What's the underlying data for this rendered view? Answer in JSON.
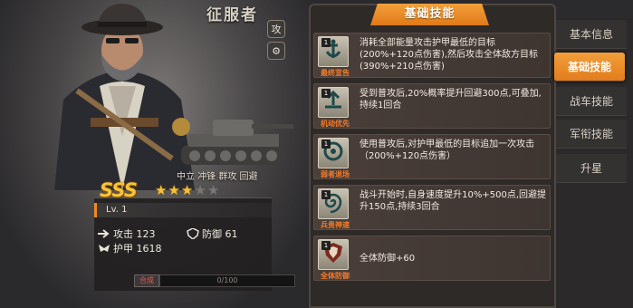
{
  "character": {
    "name": "征服者",
    "traits": "中立 冲锋 群攻 回避",
    "grade": "SSS",
    "stars_filled": 3,
    "stars_total": 5,
    "level": "Lv. 1",
    "attack": "攻击 123",
    "defense": "防御 61",
    "armor": "护甲 1618",
    "merge_label": "合成",
    "exp_text": "0/100",
    "exp_fraction": 0.0
  },
  "side_buttons": [
    "攻",
    "设"
  ],
  "panel": {
    "title": "基础技能"
  },
  "skills": [
    {
      "level": "1",
      "name": "最终宣告",
      "desc": "消耗全部能量攻击护甲最低的目标(200%+120点伤害),然后攻击全体敌方目标(390%+210点伤害)",
      "icon": "anchor-icon"
    },
    {
      "level": "1",
      "name": "机动优先",
      "desc": "受到普攻后,20%概率提升回避300点,可叠加,持续1回合",
      "icon": "arrow-up-icon"
    },
    {
      "level": "1",
      "name": "弱者退场",
      "desc": "使用普攻后,对护甲最低的目标追加一次攻击（200%+120点伤害）",
      "icon": "target-icon"
    },
    {
      "level": "1",
      "name": "兵贵神速",
      "desc": "战斗开始时,自身速度提升10%+500点,回避提升150点,持续3回合",
      "icon": "swirl-icon"
    },
    {
      "level": "1",
      "name": "全体防御",
      "desc": "全体防御+60",
      "icon": "shield-icon"
    }
  ],
  "tabs": [
    "基本信息",
    "基础技能",
    "战车技能",
    "军衔技能",
    "升星"
  ],
  "active_tab": 1,
  "colors": {
    "accent": "#e8861f",
    "skill_name": "#f47a2a",
    "star": "#f3c13a"
  }
}
